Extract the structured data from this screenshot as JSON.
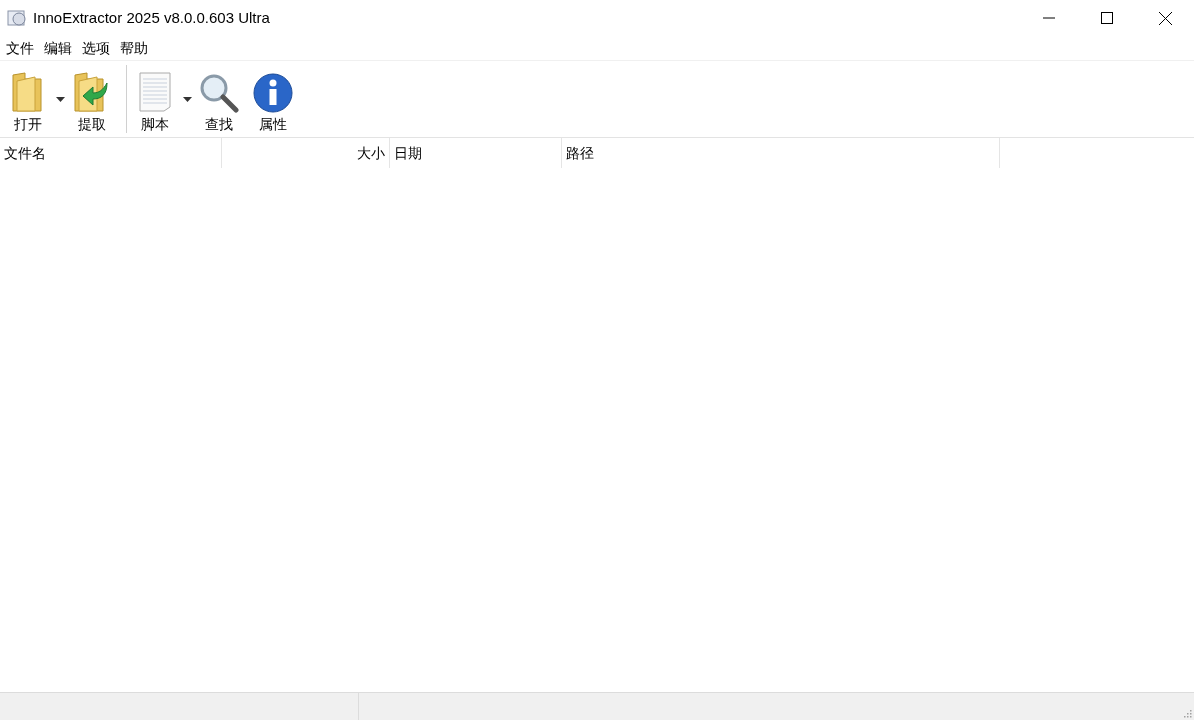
{
  "window": {
    "title": "InnoExtractor 2025 v8.0.0.603 Ultra"
  },
  "menu": [
    "文件",
    "编辑",
    "选项",
    "帮助"
  ],
  "toolbar": [
    {
      "label": "打开",
      "kind": "open",
      "dropdown": true
    },
    {
      "label": "提取",
      "kind": "extract",
      "dropdown": false
    },
    {
      "label": "脚本",
      "kind": "script",
      "dropdown": true
    },
    {
      "label": "查找",
      "kind": "find",
      "dropdown": false
    },
    {
      "label": "属性",
      "kind": "info",
      "dropdown": false
    }
  ],
  "table": {
    "columns": [
      {
        "label": "文件名",
        "kind": "text"
      },
      {
        "label": "大小",
        "kind": "numeric"
      },
      {
        "label": "日期",
        "kind": "text"
      },
      {
        "label": "路径",
        "kind": "text"
      }
    ]
  }
}
